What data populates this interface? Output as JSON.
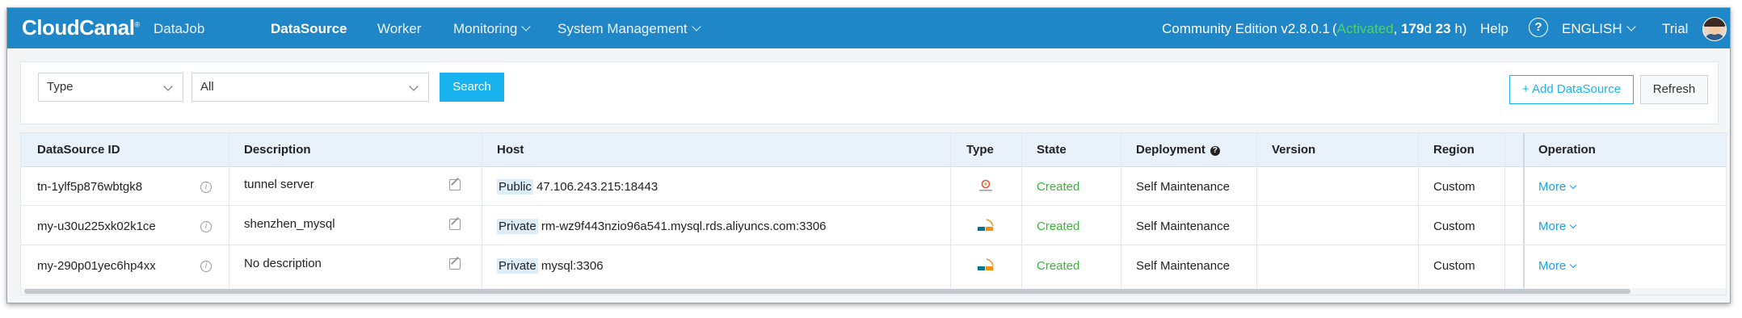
{
  "app": {
    "logo": "CloudCanal",
    "logo_mark": "®"
  },
  "nav": {
    "items": [
      {
        "label": "DataJob"
      },
      {
        "label": "DataSource"
      },
      {
        "label": "Worker"
      },
      {
        "label": "Monitoring"
      },
      {
        "label": "System Management"
      }
    ]
  },
  "header_right": {
    "edition": "Community Edition v2.8.0.1",
    "open_paren": "(",
    "activated": "Activated",
    "comma": ",",
    "days_num": "179",
    "days_unit": "d",
    "hours_num": "23",
    "hours_unit": "h)",
    "help": "Help",
    "question_mark": "?",
    "language": "ENGLISH",
    "trial": "Trial"
  },
  "filters": {
    "type_select": "Type",
    "all_select": "All",
    "search_button": "Search",
    "add_button": "+ Add DataSource",
    "refresh_button": "Refresh"
  },
  "table": {
    "columns": {
      "id": "DataSource ID",
      "description": "Description",
      "host": "Host",
      "type": "Type",
      "state": "State",
      "deployment": "Deployment",
      "deployment_hint": "?",
      "version": "Version",
      "region": "Region",
      "operation": "Operation"
    },
    "info_glyph": "i",
    "rows": [
      {
        "id": "tn-1ylf5p876wbtgk8",
        "description": "tunnel server",
        "host_tag": "Public",
        "host": "47.106.243.215:18443",
        "type_icon": "tunnel-icon",
        "state": "Created",
        "deployment": "Self Maintenance",
        "version": "",
        "region": "Custom",
        "operation": "More"
      },
      {
        "id": "my-u30u225xk02k1ce",
        "description": "shenzhen_mysql",
        "host_tag": "Private",
        "host": "rm-wz9f443nzio96a541.mysql.rds.aliyuncs.com:3306",
        "type_icon": "mysql-icon",
        "state": "Created",
        "deployment": "Self Maintenance",
        "version": "",
        "region": "Custom",
        "operation": "More"
      },
      {
        "id": "my-290p01yec6hp4xx",
        "description": "No description",
        "host_tag": "Private",
        "host": "mysql:3306",
        "type_icon": "mysql-icon",
        "state": "Created",
        "deployment": "Self Maintenance",
        "version": "",
        "region": "Custom",
        "operation": "More"
      }
    ]
  },
  "colors": {
    "topbar": "#1f86c8",
    "accent": "#19b4f0",
    "activated": "#4fd16a",
    "state_created": "#3cb43c",
    "link": "#19a0e6"
  }
}
